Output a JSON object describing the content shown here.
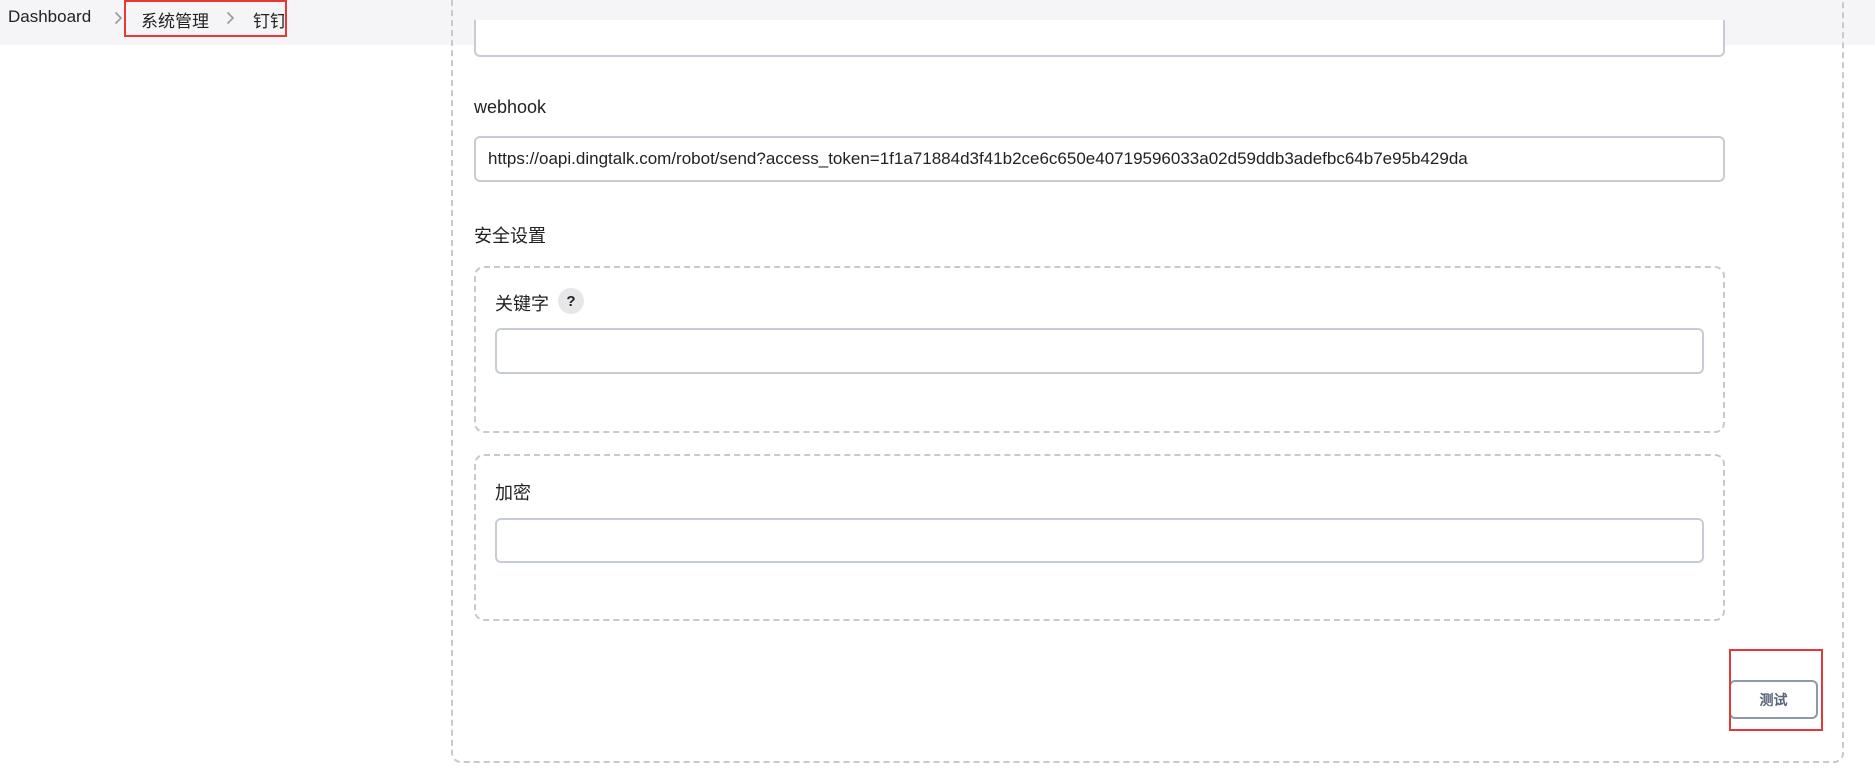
{
  "breadcrumb": {
    "items": [
      "Dashboard",
      "系统管理",
      "钉钉"
    ]
  },
  "form": {
    "webhook": {
      "label": "webhook",
      "value": "https://oapi.dingtalk.com/robot/send?access_token=1f1a71884d3f41b2ce6c650e40719596033a02d59ddb3adefbc64b7e95b429da"
    },
    "security": {
      "title": "安全设置",
      "keyword": {
        "label": "关键字",
        "help": "?",
        "value": ""
      },
      "encrypt": {
        "label": "加密",
        "value": ""
      }
    },
    "test_button": "测试"
  },
  "colors": {
    "highlight": "#e53935",
    "dashed_border": "#c9c9c9",
    "input_border": "#c5ccd3"
  }
}
